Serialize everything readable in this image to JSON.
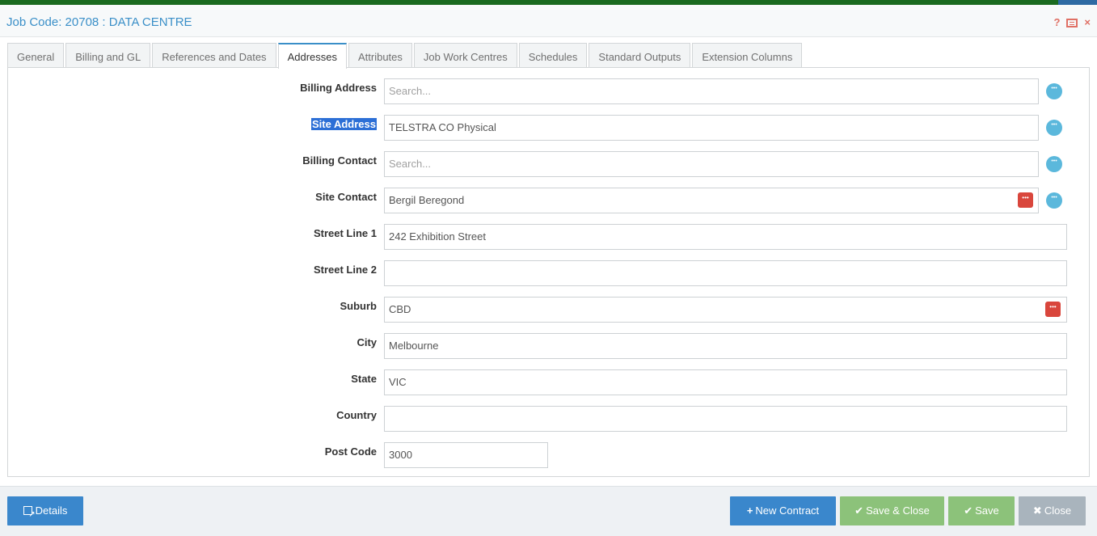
{
  "header": {
    "title": "Job Code: 20708 : DATA CENTRE",
    "help": "?",
    "close": "×"
  },
  "tabs": [
    {
      "label": "General"
    },
    {
      "label": "Billing and GL"
    },
    {
      "label": "References and Dates"
    },
    {
      "label": "Addresses",
      "active": true
    },
    {
      "label": "Attributes"
    },
    {
      "label": "Job Work Centres"
    },
    {
      "label": "Schedules"
    },
    {
      "label": "Standard Outputs"
    },
    {
      "label": "Extension Columns"
    }
  ],
  "form": {
    "billing_address": {
      "label": "Billing Address",
      "value": "",
      "placeholder": "Search..."
    },
    "site_address": {
      "label": "Site Address",
      "value": "TELSTRA CO Physical"
    },
    "billing_contact": {
      "label": "Billing Contact",
      "value": "",
      "placeholder": "Search..."
    },
    "site_contact": {
      "label": "Site Contact",
      "value": "Bergil Beregond"
    },
    "street_line_1": {
      "label": "Street Line 1",
      "value": "242 Exhibition Street"
    },
    "street_line_2": {
      "label": "Street Line 2",
      "value": ""
    },
    "suburb": {
      "label": "Suburb",
      "value": "CBD"
    },
    "city": {
      "label": "City",
      "value": "Melbourne"
    },
    "state": {
      "label": "State",
      "value": "VIC"
    },
    "country": {
      "label": "Country",
      "value": ""
    },
    "post_code": {
      "label": "Post Code",
      "value": "3000"
    }
  },
  "footer": {
    "details": "Details",
    "new_contract": "New Contract",
    "save_close": "Save & Close",
    "save": "Save",
    "close": "Close"
  },
  "colors": {
    "accent": "#3a87cc",
    "success": "#8cc27a",
    "danger": "#d9463c",
    "muted": "#a9b4bd",
    "lookup": "#5bb8dc"
  }
}
